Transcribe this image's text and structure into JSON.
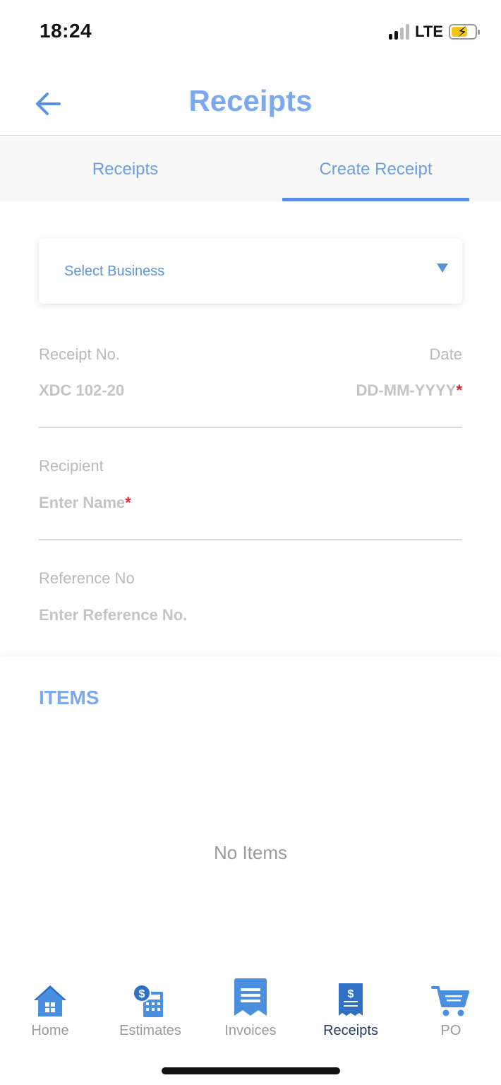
{
  "status_bar": {
    "time": "18:24",
    "network": "LTE"
  },
  "header": {
    "title": "Receipts"
  },
  "tabs": [
    {
      "label": "Receipts",
      "active": false
    },
    {
      "label": "Create Receipt",
      "active": true
    }
  ],
  "form": {
    "business_select": {
      "placeholder": "Select Business"
    },
    "receipt_no": {
      "label": "Receipt No.",
      "value": "XDC 102-20"
    },
    "date": {
      "label": "Date",
      "placeholder": "DD-MM-YYYY",
      "required_mark": "*"
    },
    "recipient": {
      "label": "Recipient",
      "placeholder": "Enter Name",
      "required_mark": "*"
    },
    "reference": {
      "label": "Reference No",
      "placeholder": "Enter Reference No."
    }
  },
  "items": {
    "title": "ITEMS",
    "empty_text": "No Items"
  },
  "bottom_nav": [
    {
      "label": "Home",
      "icon": "home-icon",
      "active": false
    },
    {
      "label": "Estimates",
      "icon": "estimates-icon",
      "active": false
    },
    {
      "label": "Invoices",
      "icon": "invoices-icon",
      "active": false
    },
    {
      "label": "Receipts",
      "icon": "receipts-icon",
      "active": true
    },
    {
      "label": "PO",
      "icon": "cart-icon",
      "active": false
    }
  ],
  "colors": {
    "accent": "#7ba8ef",
    "tab_underline": "#5b8fe6",
    "required": "#e0242b",
    "nav_active": "#1f3d66",
    "nav_icon": "#4a8fe0"
  }
}
